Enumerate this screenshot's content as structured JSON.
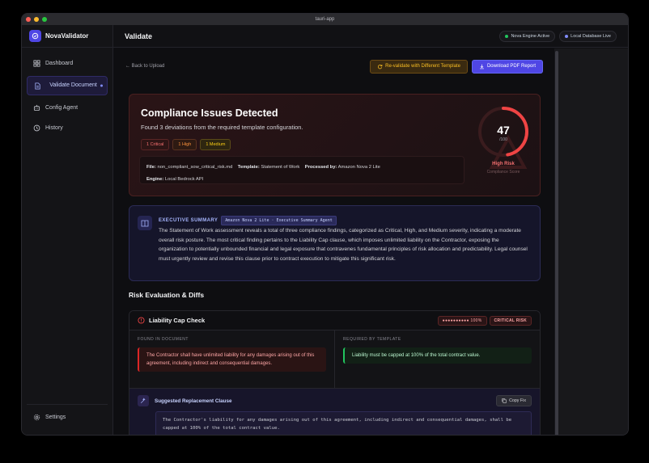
{
  "window": {
    "title": "tauri-app"
  },
  "brand": {
    "name": "NovaValidator"
  },
  "nav": {
    "items": [
      {
        "label": "Dashboard"
      },
      {
        "label": "Validate Document"
      },
      {
        "label": "Config Agent"
      },
      {
        "label": "History"
      }
    ],
    "settings": "Settings"
  },
  "topbar": {
    "title": "Validate",
    "status1": "Nova Engine Active",
    "status2": "Local Database Live"
  },
  "actions": {
    "back": "← Back to Upload",
    "revalidate": "Re-validate with Different Template",
    "download": "Download PDF Report"
  },
  "summary": {
    "title": "Compliance Issues Detected",
    "subtitle": "Found 3 deviations from the required template configuration.",
    "badges": [
      "1 Critical",
      "1 High",
      "1 Medium"
    ],
    "file_label": "File:",
    "file": "non_compliant_sow_critical_risk.md",
    "template_label": "Template:",
    "template": "Statement of Work",
    "processed_label": "Processed by:",
    "processed": "Amazon Nova 2 Lite",
    "engine_label": "Engine:",
    "engine": "Local Bedrock API",
    "score": "47",
    "score_max": "/100",
    "score_value": 47,
    "risk": "High Risk",
    "score_label": "Compliance Score"
  },
  "executive": {
    "heading": "EXECUTIVE SUMMARY",
    "agent": "Amazon Nova 2 Lite · Executive Summary Agent",
    "text": "The Statement of Work assessment reveals a total of three compliance findings, categorized as Critical, High, and Medium severity, indicating a moderate overall risk posture. The most critical finding pertains to the Liability Cap clause, which imposes unlimited liability on the Contractor, exposing the organization to potentially unbounded financial and legal exposure that contravenes fundamental principles of risk allocation and predictability. Legal counsel must urgently review and revise this clause prior to contract execution to mitigate this significant risk."
  },
  "section": {
    "title": "Risk Evaluation & Diffs"
  },
  "check": {
    "title": "Liability Cap Check",
    "confidence": "●●●●●●●●●● 100%",
    "severity": "CRITICAL RISK",
    "found_label": "FOUND IN DOCUMENT",
    "found": "The Contractor shall have unlimited liability for any damages arising out of this agreement, including indirect and consequential damages.",
    "required_label": "REQUIRED BY TEMPLATE",
    "required": "Liability must be capped at 100% of the total contract value.",
    "suggest_label": "Suggested Replacement Clause",
    "copy": "Copy Fix",
    "suggestion": "The Contractor's liability for any damages arising out of this agreement, including indirect and consequential damages, shall be capped at 100% of the total contract value."
  },
  "colors": {
    "accent": "#4f46e5",
    "danger": "#ef4444",
    "success": "#22c55e"
  }
}
